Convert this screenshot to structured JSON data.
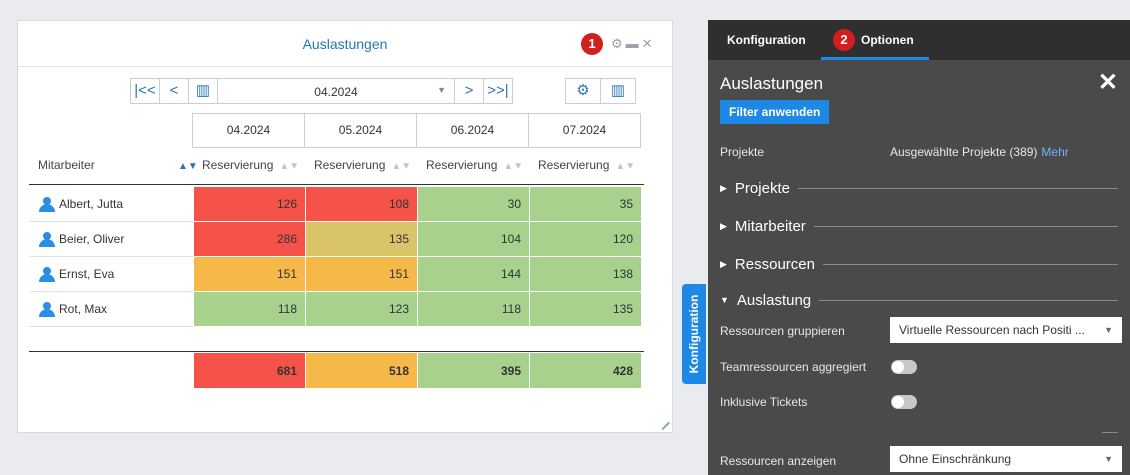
{
  "widget": {
    "title": "Auslastungen",
    "badge": "1"
  },
  "toolbar": {
    "period": "04.2024",
    "icons": [
      "first-page-icon",
      "prev-icon",
      "calendar-icon",
      "next-icon",
      "last-page-icon",
      "settings-icon",
      "columns-icon"
    ]
  },
  "table": {
    "months": [
      "04.2024",
      "05.2024",
      "06.2024",
      "07.2024"
    ],
    "employee_header": "Mitarbeiter",
    "value_header": "Reservierung",
    "rows": [
      {
        "name": "Albert, Jutta",
        "values": [
          "126",
          "108",
          "30",
          "35"
        ]
      },
      {
        "name": "Beier, Oliver",
        "values": [
          "286",
          "135",
          "104",
          "120"
        ]
      },
      {
        "name": "Ernst, Eva",
        "values": [
          "151",
          "151",
          "144",
          "138"
        ]
      },
      {
        "name": "Rot, Max",
        "values": [
          "118",
          "123",
          "118",
          "135"
        ]
      }
    ],
    "totals": [
      "681",
      "518",
      "395",
      "428"
    ],
    "colors": {
      "red": "#f5534a",
      "olive": "#d9c46a",
      "orange": "#f7b84a",
      "green": "#a9d18e"
    },
    "cell_colors": [
      [
        "red",
        "red",
        "green",
        "green"
      ],
      [
        "red",
        "olive",
        "green",
        "green"
      ],
      [
        "orange",
        "orange",
        "green",
        "green"
      ],
      [
        "green",
        "green",
        "green",
        "green"
      ]
    ],
    "total_colors": [
      "red",
      "orange",
      "green",
      "green"
    ]
  },
  "side_tab": "Konfiguration",
  "panel": {
    "tabs": [
      "Konfiguration",
      "Optionen"
    ],
    "active_tab": "Optionen",
    "badge": "2",
    "title": "Auslastungen",
    "filter_button": "Filter anwenden",
    "projects_label": "Projekte",
    "projects_value": "Ausgewählte Projekte (389)",
    "projects_more": "Mehr",
    "sections": [
      "Projekte",
      "Mitarbeiter",
      "Ressourcen",
      "Auslastung"
    ],
    "group_label": "Ressourcen gruppieren",
    "group_value": "Virtuelle Ressourcen nach Positi ...",
    "team_label": "Teamressourcen aggregiert",
    "tickets_label": "Inklusive Tickets",
    "show_label": "Ressourcen anzeigen",
    "show_value": "Ohne Einschränkung"
  }
}
